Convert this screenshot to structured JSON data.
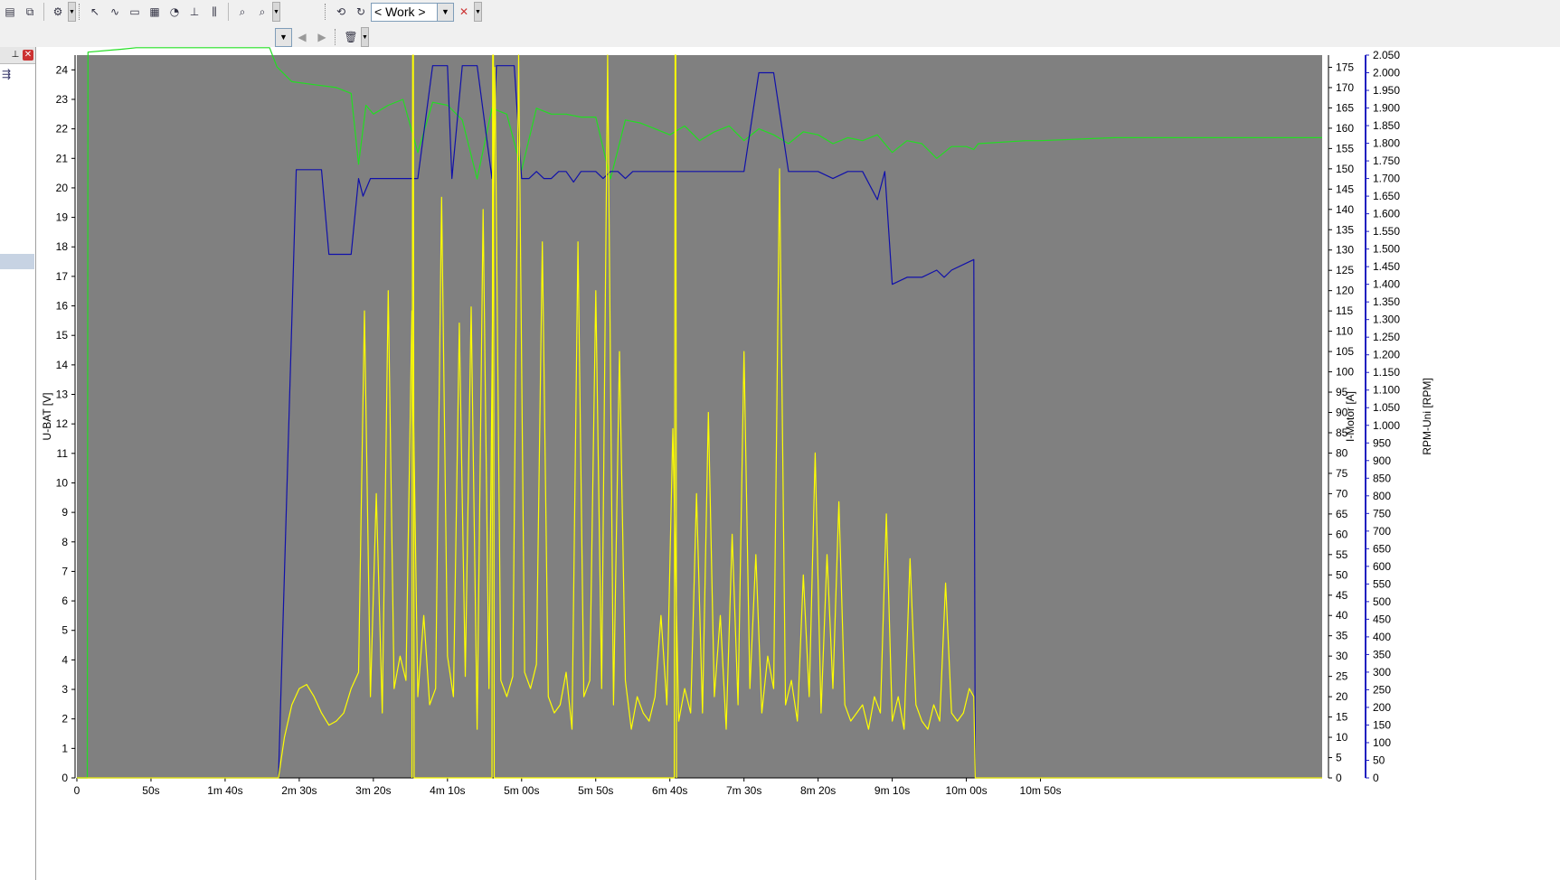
{
  "toolbar": {
    "view_combo_value": "< Work >",
    "icons": [
      "print-preview-icon",
      "copy-icon",
      "settings-icon",
      "cursor-icon",
      "curve-icon",
      "window-icon",
      "table-icon",
      "gauge-icon",
      "axis-icon",
      "bars-icon",
      "zoom-icon",
      "zoom-out-icon",
      "connect-icon",
      "refresh-icon",
      "combo-dropdown-icon",
      "disconnect-icon"
    ],
    "nav_icons": [
      "combo-dropdown-icon",
      "back-icon",
      "forward-icon",
      "delete-icon"
    ]
  },
  "sidepanel": {
    "pin_icon": "pin-icon",
    "close_icon": "close-icon",
    "tree_icon": "tree-icon"
  },
  "chart_data": {
    "type": "line",
    "background": "#808080",
    "x_axis": {
      "unit": "s",
      "range": [
        0,
        840
      ],
      "ticks": [
        0,
        50,
        100,
        150,
        200,
        250,
        300,
        350,
        400,
        450,
        500,
        550,
        600,
        650
      ],
      "tick_labels": [
        "0",
        "50s",
        "1m 40s",
        "2m 30s",
        "3m 20s",
        "4m 10s",
        "5m 00s",
        "5m 50s",
        "6m 40s",
        "7m 30s",
        "8m 20s",
        "9m 10s",
        "10m 00s",
        "10m 50s"
      ]
    },
    "axes": [
      {
        "id": "ubat",
        "label": "U-BAT [V]",
        "side": "left",
        "range": [
          0,
          24.5
        ],
        "ticks": [
          0,
          1,
          2,
          3,
          4,
          5,
          6,
          7,
          8,
          9,
          10,
          11,
          12,
          13,
          14,
          15,
          16,
          17,
          18,
          19,
          20,
          21,
          22,
          23,
          24
        ],
        "color": "#000000"
      },
      {
        "id": "imotor",
        "label": "I-Motor [A]",
        "side": "right",
        "range": [
          0,
          178
        ],
        "ticks": [
          0,
          5,
          10,
          15,
          20,
          25,
          30,
          35,
          40,
          45,
          50,
          55,
          60,
          65,
          70,
          75,
          80,
          85,
          90,
          95,
          100,
          105,
          110,
          115,
          120,
          125,
          130,
          135,
          140,
          145,
          150,
          155,
          160,
          165,
          170,
          175
        ],
        "color": "#000000"
      },
      {
        "id": "rpm",
        "label": "RPM-Uni [RPM]",
        "side": "right",
        "range": [
          0,
          2050
        ],
        "ticks": [
          0,
          50,
          100,
          150,
          200,
          250,
          300,
          350,
          400,
          450,
          500,
          550,
          600,
          650,
          700,
          750,
          800,
          850,
          900,
          950,
          1000,
          1050,
          1100,
          1150,
          1200,
          1250,
          1300,
          1350,
          1400,
          1450,
          1500,
          1550,
          1600,
          1650,
          1700,
          1750,
          1800,
          1850,
          1900,
          1950,
          2000,
          2050
        ],
        "tick_labels": [
          "0",
          "50",
          "100",
          "150",
          "200",
          "250",
          "300",
          "350",
          "400",
          "450",
          "500",
          "550",
          "600",
          "650",
          "700",
          "750",
          "800",
          "850",
          "900",
          "950",
          "1.000",
          "1.050",
          "1.100",
          "1.150",
          "1.200",
          "1.250",
          "1.300",
          "1.350",
          "1.400",
          "1.450",
          "1.500",
          "1.550",
          "1.600",
          "1.650",
          "1.700",
          "1.750",
          "1.800",
          "1.850",
          "1.900",
          "1.950",
          "2.000",
          "2.050"
        ],
        "color": "#2020c0"
      }
    ],
    "series": [
      {
        "axis": "ubat",
        "color": "#22dd22",
        "x": [
          0,
          7,
          7.5,
          30,
          40,
          130,
          135,
          145,
          160,
          175,
          185,
          190,
          195,
          200,
          210,
          220,
          230,
          240,
          250,
          260,
          270,
          280,
          290,
          300,
          310,
          320,
          330,
          340,
          350,
          360,
          370,
          380,
          390,
          400,
          410,
          420,
          430,
          440,
          450,
          460,
          470,
          480,
          490,
          500,
          510,
          520,
          530,
          540,
          550,
          560,
          570,
          580,
          590,
          600,
          605,
          608,
          640,
          650,
          700,
          840
        ],
        "y": [
          0,
          0,
          24.6,
          24.7,
          24.75,
          24.75,
          24.1,
          23.6,
          23.5,
          23.4,
          23.2,
          20.8,
          22.8,
          22.5,
          22.8,
          23.0,
          21.2,
          22.9,
          22.8,
          22.3,
          20.3,
          22.7,
          22.5,
          20.6,
          22.7,
          22.5,
          22.5,
          22.4,
          22.4,
          20.3,
          22.3,
          22.2,
          22.0,
          21.8,
          22.1,
          21.6,
          21.9,
          22.1,
          21.6,
          22.0,
          21.8,
          21.5,
          21.9,
          21.8,
          21.5,
          21.7,
          21.6,
          21.8,
          21.2,
          21.6,
          21.5,
          21.0,
          21.4,
          21.4,
          21.3,
          21.5,
          21.6,
          21.6,
          21.7,
          21.7
        ]
      },
      {
        "axis": "rpm",
        "color": "#1010aa",
        "x": [
          0,
          136,
          148,
          150,
          160,
          165,
          170,
          175,
          180,
          185,
          190,
          193,
          198,
          203,
          210,
          220,
          230,
          240,
          250,
          253,
          260,
          270,
          280,
          283,
          290,
          295,
          300,
          305,
          310,
          315,
          320,
          325,
          330,
          335,
          340,
          345,
          350,
          355,
          360,
          365,
          370,
          375,
          380,
          390,
          400,
          410,
          420,
          430,
          440,
          450,
          460,
          470,
          480,
          490,
          500,
          510,
          520,
          530,
          540,
          545,
          550,
          560,
          570,
          580,
          585,
          590,
          600,
          605,
          606,
          840
        ],
        "y": [
          0,
          0,
          1725,
          1725,
          1725,
          1725,
          1485,
          1485,
          1485,
          1485,
          1700,
          1650,
          1700,
          1700,
          1700,
          1700,
          1700,
          2020,
          2020,
          1700,
          2020,
          2020,
          1700,
          2020,
          2020,
          2020,
          1700,
          1700,
          1720,
          1700,
          1700,
          1720,
          1720,
          1690,
          1720,
          1720,
          1720,
          1700,
          1720,
          1720,
          1700,
          1720,
          1720,
          1720,
          1720,
          1720,
          1720,
          1720,
          1720,
          1720,
          2000,
          2000,
          1720,
          1720,
          1720,
          1700,
          1720,
          1720,
          1640,
          1720,
          1400,
          1420,
          1420,
          1440,
          1420,
          1440,
          1460,
          1470,
          0,
          0
        ]
      },
      {
        "axis": "imotor",
        "color": "#ffff00",
        "x": [
          0,
          136,
          140,
          145,
          150,
          155,
          160,
          165,
          170,
          175,
          180,
          185,
          190,
          194,
          198,
          202,
          206,
          210,
          214,
          218,
          222,
          226,
          230,
          234,
          238,
          242,
          246,
          250,
          254,
          258,
          262,
          266,
          270,
          274,
          278,
          282,
          286,
          290,
          294,
          298,
          302,
          306,
          310,
          314,
          318,
          322,
          326,
          330,
          334,
          338,
          342,
          346,
          350,
          354,
          358,
          362,
          366,
          370,
          374,
          378,
          382,
          386,
          390,
          394,
          398,
          402,
          406,
          410,
          414,
          418,
          422,
          426,
          430,
          434,
          438,
          442,
          446,
          450,
          454,
          458,
          462,
          466,
          470,
          474,
          478,
          482,
          486,
          490,
          494,
          498,
          502,
          506,
          510,
          514,
          518,
          522,
          526,
          530,
          534,
          538,
          542,
          546,
          550,
          554,
          558,
          562,
          566,
          570,
          574,
          578,
          582,
          586,
          590,
          594,
          598,
          602,
          605,
          606,
          840
        ],
        "y": [
          0,
          0,
          10,
          18,
          22,
          23,
          20,
          16,
          13,
          14,
          16,
          22,
          26,
          115,
          20,
          70,
          16,
          120,
          22,
          30,
          24,
          115,
          20,
          40,
          18,
          22,
          143,
          30,
          20,
          112,
          25,
          116,
          12,
          140,
          22,
          175,
          24,
          20,
          25,
          178,
          26,
          22,
          28,
          132,
          20,
          16,
          18,
          26,
          12,
          132,
          20,
          24,
          120,
          22,
          178,
          18,
          105,
          24,
          12,
          20,
          16,
          14,
          20,
          40,
          18,
          86,
          14,
          22,
          16,
          70,
          16,
          90,
          20,
          40,
          12,
          60,
          18,
          105,
          22,
          55,
          16,
          30,
          22,
          150,
          18,
          24,
          14,
          50,
          20,
          80,
          16,
          55,
          22,
          68,
          18,
          14,
          16,
          18,
          12,
          20,
          16,
          65,
          14,
          20,
          12,
          54,
          18,
          14,
          12,
          18,
          14,
          48,
          16,
          14,
          16,
          22,
          20,
          0,
          0
        ]
      },
      {
        "axis": "imotor",
        "color": "#ffff00",
        "x": [
          226,
          226.5,
          227,
          227.5,
          280,
          280.5,
          281,
          281.5,
          403,
          403.5,
          404,
          404.5
        ],
        "y": [
          0,
          178,
          178,
          0,
          0,
          178,
          178,
          0,
          0,
          178,
          178,
          0
        ]
      }
    ]
  }
}
